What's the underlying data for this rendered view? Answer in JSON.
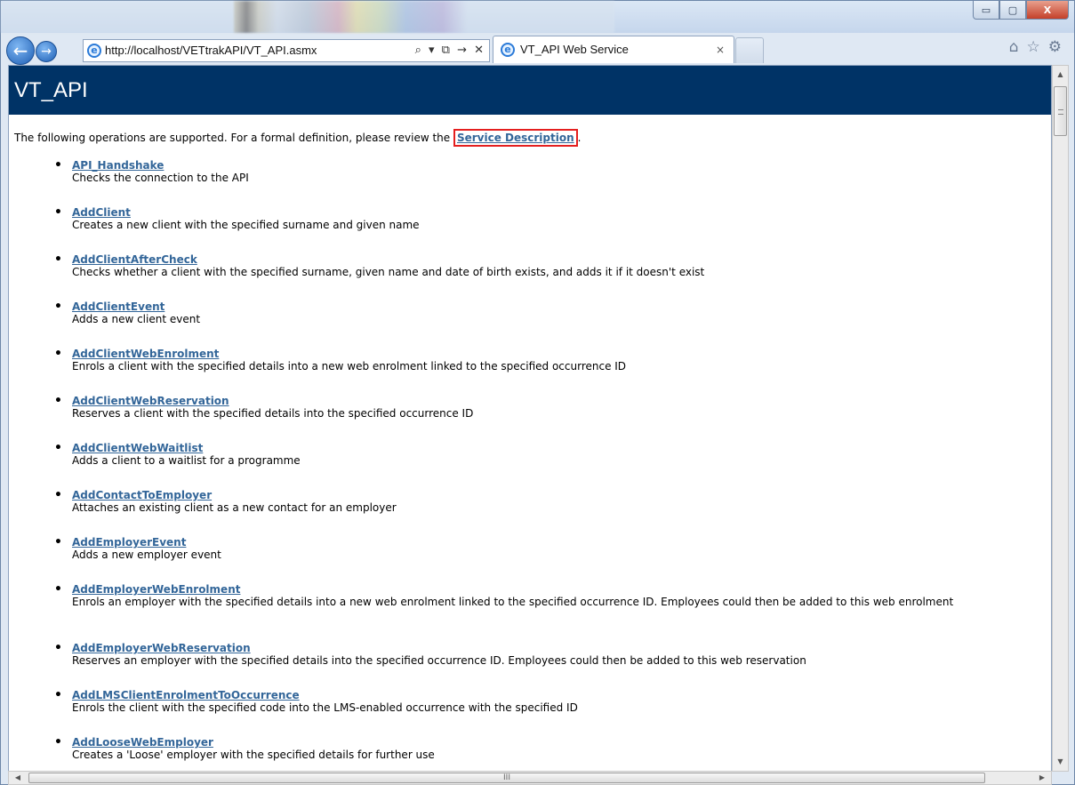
{
  "browser": {
    "url": "http://localhost/VETtrakAPI/VT_API.asmx",
    "address_tools": "⌕ ▾ ⧉ → ✕",
    "tab_title": "VT_API Web Service",
    "tab_close": "×",
    "window_controls": {
      "minimize": "▭",
      "maximize": "▢",
      "close": "X"
    },
    "right_icons": [
      "home-icon",
      "star-icon",
      "gear-icon"
    ]
  },
  "page": {
    "heading": "VT_API",
    "intro_text": "The following operations are supported. For a formal definition, please review the ",
    "intro_link": "Service Description",
    "intro_end": ".",
    "operations": [
      {
        "name": "API_Handshake",
        "desc": "Checks the connection to the API"
      },
      {
        "name": "AddClient",
        "desc": "Creates a new client with the specified surname and given name"
      },
      {
        "name": "AddClientAfterCheck",
        "desc": "Checks whether a client with the specified surname, given name and date of birth exists, and adds it if it doesn't exist"
      },
      {
        "name": "AddClientEvent",
        "desc": "Adds a new client event"
      },
      {
        "name": "AddClientWebEnrolment",
        "desc": "Enrols a client with the specified details into a new web enrolment linked to the specified occurrence ID"
      },
      {
        "name": "AddClientWebReservation",
        "desc": "Reserves a client with the specified details into the specified occurrence ID"
      },
      {
        "name": "AddClientWebWaitlist",
        "desc": "Adds a client to a waitlist for a programme"
      },
      {
        "name": "AddContactToEmployer",
        "desc": "Attaches an existing client as a new contact for an employer"
      },
      {
        "name": "AddEmployerEvent",
        "desc": "Adds a new employer event"
      },
      {
        "name": "AddEmployerWebEnrolment",
        "desc": "Enrols an employer with the specified details into a new web enrolment linked to the specified occurrence ID. Employees could then be added to this web enrolment"
      },
      {
        "name": "AddEmployerWebReservation",
        "desc": "Reserves an employer with the specified details into the specified occurrence ID. Employees could then be added to this web reservation"
      },
      {
        "name": "AddLMSClientEnrolmentToOccurrence",
        "desc": "Enrols the client with the specified code into the LMS-enabled occurrence with the specified ID"
      },
      {
        "name": "AddLooseWebEmployer",
        "desc": "Creates a 'Loose' employer with the specified details for further use"
      }
    ]
  },
  "scrollbar": {
    "hgrip": "III"
  },
  "colors": {
    "heading_bg": "#003366",
    "link": "#336699",
    "highlight": "#e41f1f"
  }
}
